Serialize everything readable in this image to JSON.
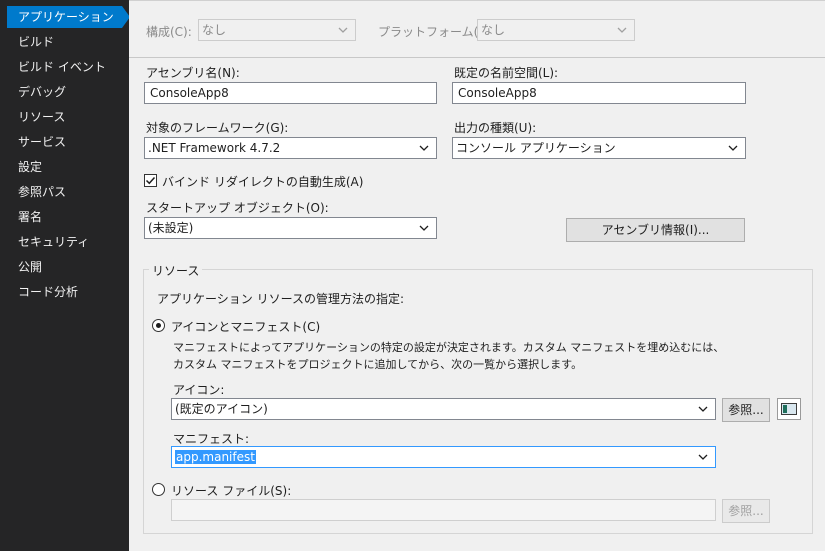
{
  "sidebar": {
    "items": [
      {
        "label": "アプリケーション",
        "active": true
      },
      {
        "label": "ビルド"
      },
      {
        "label": "ビルド イベント"
      },
      {
        "label": "デバッグ"
      },
      {
        "label": "リソース"
      },
      {
        "label": "サービス"
      },
      {
        "label": "設定"
      },
      {
        "label": "参照パス"
      },
      {
        "label": "署名"
      },
      {
        "label": "セキュリティ"
      },
      {
        "label": "公開"
      },
      {
        "label": "コード分析"
      }
    ]
  },
  "toolbar": {
    "config_label": "構成(C):",
    "config_value": "なし",
    "platform_label": "プラットフォーム(M):",
    "platform_value": "なし"
  },
  "form": {
    "assembly_name_label": "アセンブリ名(N):",
    "assembly_name_value": "ConsoleApp8",
    "namespace_label": "既定の名前空間(L):",
    "namespace_value": "ConsoleApp8",
    "framework_label": "対象のフレームワーク(G):",
    "framework_value": ".NET Framework 4.7.2",
    "output_type_label": "出力の種類(U):",
    "output_type_value": "コンソール アプリケーション",
    "binding_redirect_label": "バインド リダイレクトの自動生成(A)",
    "binding_redirect_checked": true,
    "startup_label": "スタートアップ オブジェクト(O):",
    "startup_value": "(未設定)",
    "assembly_info_button": "アセンブリ情報(I)..."
  },
  "resources": {
    "group_title": "リソース",
    "instruction": "アプリケーション リソースの管理方法の指定:",
    "icon_manifest_label": "アイコンとマニフェスト(C)",
    "icon_manifest_selected": true,
    "description": "マニフェストによってアプリケーションの特定の設定が決定されます。カスタム マニフェストを埋め込むには、カスタム マニフェストをプロジェクトに追加してから、次の一覧から選択します。",
    "icon_label": "アイコン:",
    "icon_value": "(既定のアイコン)",
    "browse_button": "参照...",
    "manifest_label": "マニフェスト:",
    "manifest_value": "app.manifest",
    "resource_file_label": "リソース ファイル(S):",
    "resource_file_value": "",
    "resource_browse_button": "参照..."
  },
  "colors": {
    "sidebar_bg": "#252526",
    "accent": "#007acc",
    "content_bg": "#f0f0f0"
  }
}
